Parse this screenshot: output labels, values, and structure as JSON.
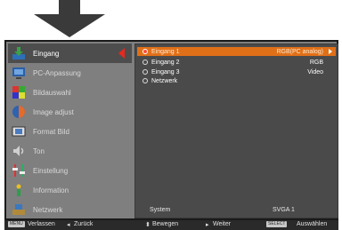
{
  "menu": {
    "items": [
      {
        "label": "Eingang",
        "icon": "input-icon",
        "selected": true
      },
      {
        "label": "PC-Anpassung",
        "icon": "pc-adjust-icon"
      },
      {
        "label": "Bildauswahl",
        "icon": "image-select-icon"
      },
      {
        "label": "Image adjust",
        "icon": "image-adjust-icon"
      },
      {
        "label": "Format Bild",
        "icon": "screen-format-icon"
      },
      {
        "label": "Ton",
        "icon": "sound-icon"
      },
      {
        "label": "Einstellung",
        "icon": "setting-icon"
      },
      {
        "label": "Information",
        "icon": "information-icon"
      },
      {
        "label": "Netzwerk",
        "icon": "network-icon"
      }
    ]
  },
  "inputs": [
    {
      "name": "Eingang 1",
      "value": "RGB(PC analog)",
      "active": true
    },
    {
      "name": "Eingang 2",
      "value": "RGB"
    },
    {
      "name": "Eingang 3",
      "value": "Video"
    },
    {
      "name": "Netzwerk",
      "value": ""
    }
  ],
  "system": {
    "label": "System",
    "value": "SVGA 1"
  },
  "help": {
    "menu_key": "MENU",
    "exit": "Verlassen",
    "back": "Zurück",
    "move": "Bewegen",
    "next": "Weiter",
    "select_key": "SELECT",
    "select": "Auswählen"
  },
  "colors": {
    "accent": "#e07018",
    "menu_bg": "#7f7f7f",
    "panel_bg": "#4a4a4a",
    "selected_arrow": "#e8281e"
  }
}
